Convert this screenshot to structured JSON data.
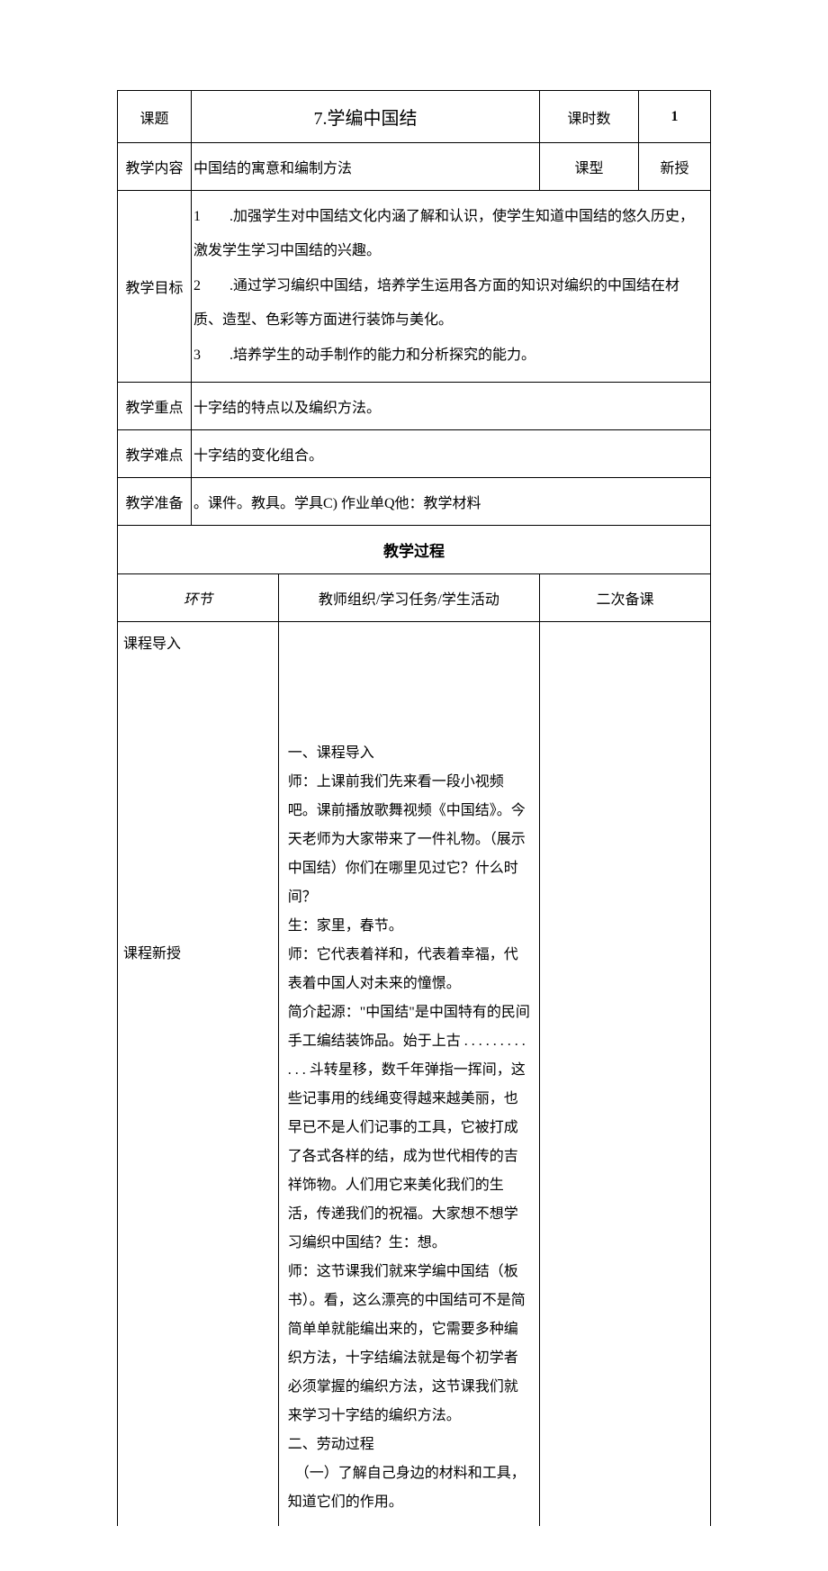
{
  "header": {
    "topic_label": "课题",
    "topic_value": "7.学编中国结",
    "hours_label": "课时数",
    "hours_value": "1",
    "content_label": "教学内容",
    "content_value": "中国结的寓意和编制方法",
    "type_label": "课型",
    "type_value": "新授"
  },
  "goals": {
    "label": "教学目标",
    "items": [
      "1　　.加强学生对中国结文化内涵了解和认识，使学生知道中国结的悠久历史，激发学生学习中国结的兴趣。",
      "2　　.通过学习编织中国结，培养学生运用各方面的知识对编织的中国结在材质、造型、色彩等方面进行装饰与美化。",
      "3　　.培养学生的动手制作的能力和分析探究的能力。"
    ]
  },
  "keypoint": {
    "label": "教学重点",
    "value": "十字结的特点以及编织方法。"
  },
  "difficulty": {
    "label": "教学难点",
    "value": "十字结的变化组合。"
  },
  "prep": {
    "label": "教学准备",
    "value": "。课件。教具。学具C) 作业单Q他：教学材料"
  },
  "process": {
    "title": "教学过程",
    "col1": "环节",
    "col2": "教师组织/学习任务/学生活动",
    "col3": "二次备课",
    "stage1": "课程导入",
    "stage2": "课程新授",
    "body": "一、课程导入\n师：上课前我们先来看一段小视频吧。课前播放歌舞视频《中国结》。今天老师为大家带来了一件礼物。（展示中国结）你们在哪里见过它？什么时间？\n生：家里，春节。\n师：它代表着祥和，代表着幸福，代表着中国人对未来的憧憬。\n简介起源：\"中国结\"是中国特有的民间手工编结装饰品。始于上古 . . . . . . . . . . . . 斗转星移，数千年弹指一挥间，这些记事用的线绳变得越来越美丽，也早已不是人们记事的工具，它被打成了各式各样的结，成为世代相传的吉祥饰物。人们用它来美化我们的生活，传递我们的祝福。大家想不想学习编织中国结？生：想。\n师：这节课我们就来学编中国结（板书）。看，这么漂亮的中国结可不是简简单单就能编出来的，它需要多种编织方法，十字结编法就是每个初学者必须掌握的编织方法，这节课我们就来学习十字结的编织方法。\n二、劳动过程\n　（一）了解自己身边的材料和工具，知道它们的作用。"
  }
}
